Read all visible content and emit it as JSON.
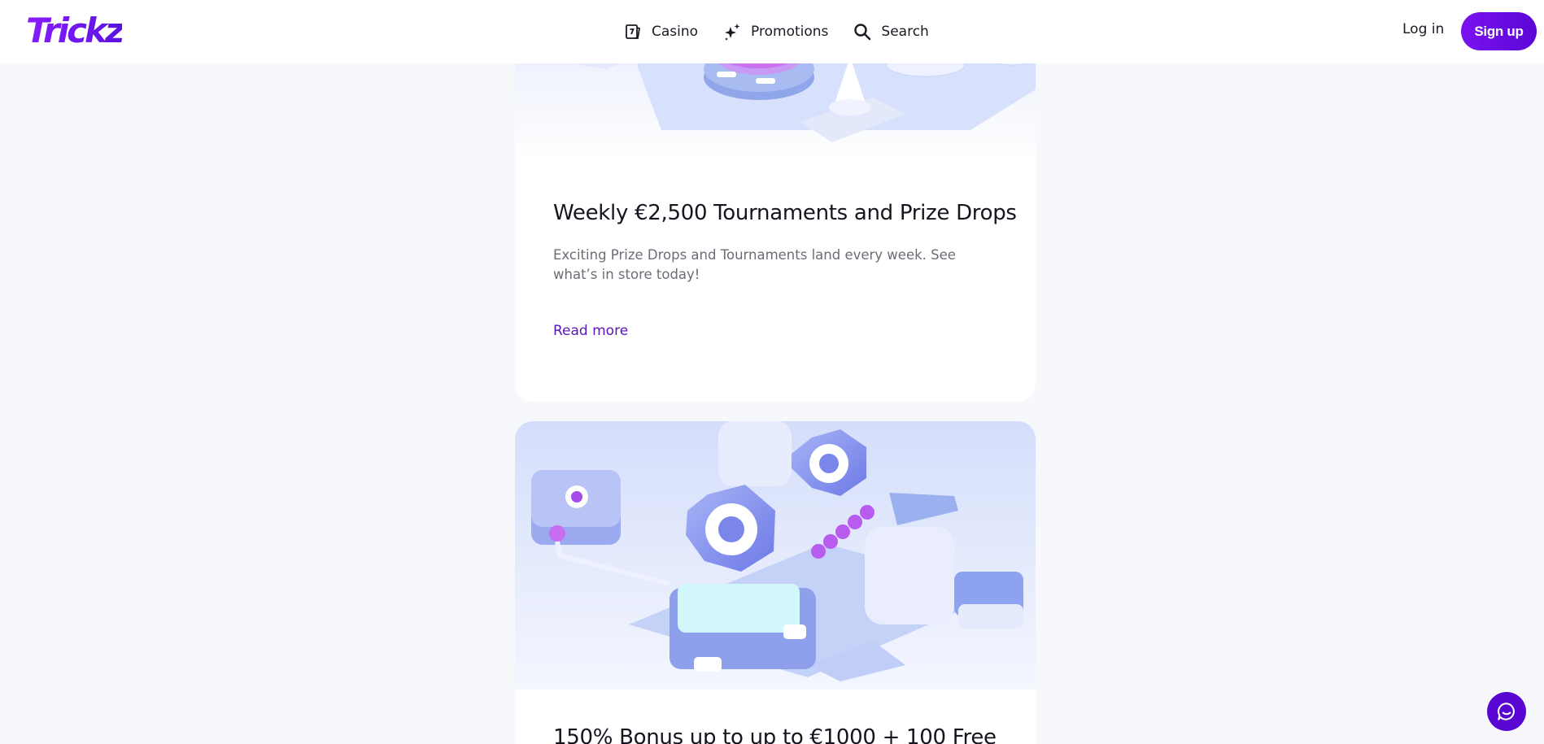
{
  "brand": {
    "logo_text": "Trickz",
    "accent_color": "#6a14ee"
  },
  "nav": {
    "items": [
      {
        "label": "Casino",
        "icon": "casino-icon"
      },
      {
        "label": "Promotions",
        "icon": "sparkle-icon"
      },
      {
        "label": "Search",
        "icon": "search-icon"
      }
    ]
  },
  "auth": {
    "login_label": "Log in",
    "signup_label": "Sign up"
  },
  "promotions": [
    {
      "title": "Weekly €2,500 Tournaments and Prize Drops",
      "description": "Exciting Prize Drops and Tournaments land every week. See what’s in store today!",
      "link_label": "Read more"
    },
    {
      "title": "150% Bonus up to up to €1000 + 100 Free"
    }
  ],
  "chat": {
    "icon": "chat-icon"
  }
}
